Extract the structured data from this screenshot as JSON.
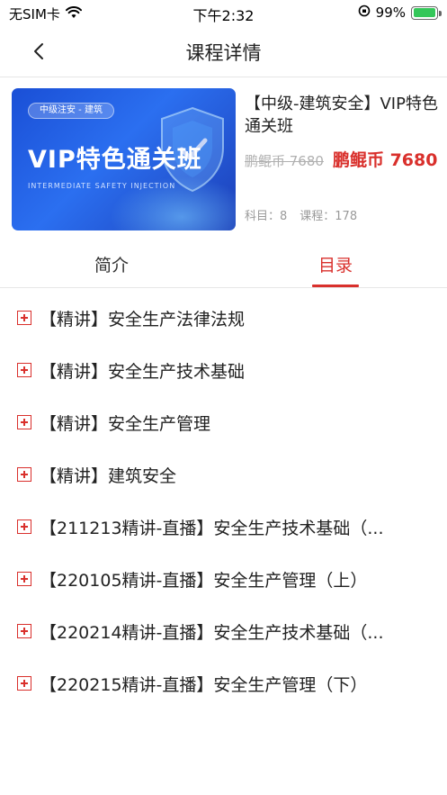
{
  "status_bar": {
    "carrier": "无SIM卡",
    "time": "下午2:32",
    "battery": "99%",
    "battery_level": 0.99
  },
  "nav": {
    "title": "课程详情"
  },
  "course": {
    "cover": {
      "tag": "中级注安 - 建筑",
      "title": "VIP特色通关班",
      "subtitle": "INTERMEDIATE SAFETY INJECTION"
    },
    "title": "【中级-建筑安全】VIP特色通关班",
    "old_price": "鹏鲲币 7680",
    "price": "鹏鲲币 7680",
    "subjects": "科目：8",
    "lessons": "课程：178"
  },
  "tabs": [
    {
      "label": "简介",
      "active": false
    },
    {
      "label": "目录",
      "active": true
    }
  ],
  "catalog": [
    {
      "label": "【精讲】安全生产法律法规"
    },
    {
      "label": "【精讲】安全生产技术基础"
    },
    {
      "label": "【精讲】安全生产管理"
    },
    {
      "label": "【精讲】建筑安全"
    },
    {
      "label": "【211213精讲-直播】安全生产技术基础（..."
    },
    {
      "label": "【220105精讲-直播】安全生产管理（上）"
    },
    {
      "label": "【220214精讲-直播】安全生产技术基础（..."
    },
    {
      "label": "【220215精讲-直播】安全生产管理（下）"
    }
  ],
  "colors": {
    "accent": "#d9302c",
    "cover_blue": "#2b6ff0"
  }
}
